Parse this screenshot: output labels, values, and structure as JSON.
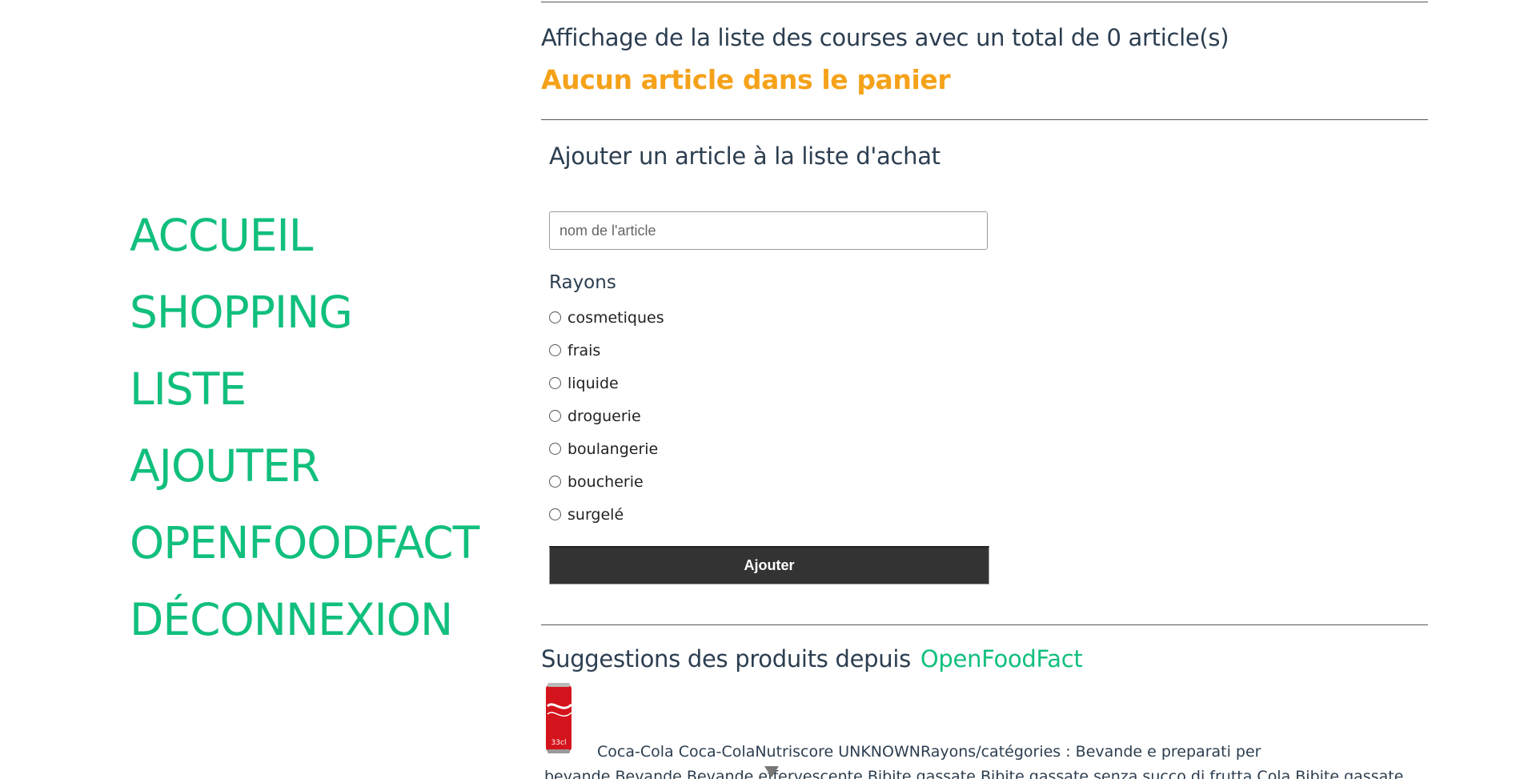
{
  "nav": {
    "items": [
      {
        "label": "ACCUEIL"
      },
      {
        "label": "SHOPPING"
      },
      {
        "label": "LISTE"
      },
      {
        "label": "AJOUTER"
      },
      {
        "label": "OPENFOODFACT"
      },
      {
        "label": "DÉCONNEXION"
      }
    ]
  },
  "summary": {
    "text": "Affichage de la liste des courses avec un total de 0 article(s)",
    "empty_message": "Aucun article dans le panier"
  },
  "form": {
    "title": "Ajouter un article à la liste d'achat",
    "name_placeholder": "nom de l'article",
    "name_value": "",
    "rayons_label": "Rayons",
    "rayons": [
      {
        "label": "cosmetiques"
      },
      {
        "label": "frais"
      },
      {
        "label": "liquide"
      },
      {
        "label": "droguerie"
      },
      {
        "label": "boulangerie"
      },
      {
        "label": "boucherie"
      },
      {
        "label": "surgelé"
      }
    ],
    "submit_label": "Ajouter"
  },
  "suggestions": {
    "title": "Suggestions des produits depuis",
    "link_label": "OpenFoodFact",
    "product_text": "Coca-Cola Coca-ColaNutriscore UNKNOWNRayons/catégories : Bevande e preparati per bevande,Bevande,Bevande effervescente,Bibite gassate,Bibite gassate senza succo di frutta,Cola,Bibite gassate zuccherate",
    "can_label": "33cl"
  },
  "colors": {
    "accent": "#11bf7d",
    "warning": "#f5a21a",
    "text": "#2c3e50",
    "button_bg": "#333333"
  }
}
